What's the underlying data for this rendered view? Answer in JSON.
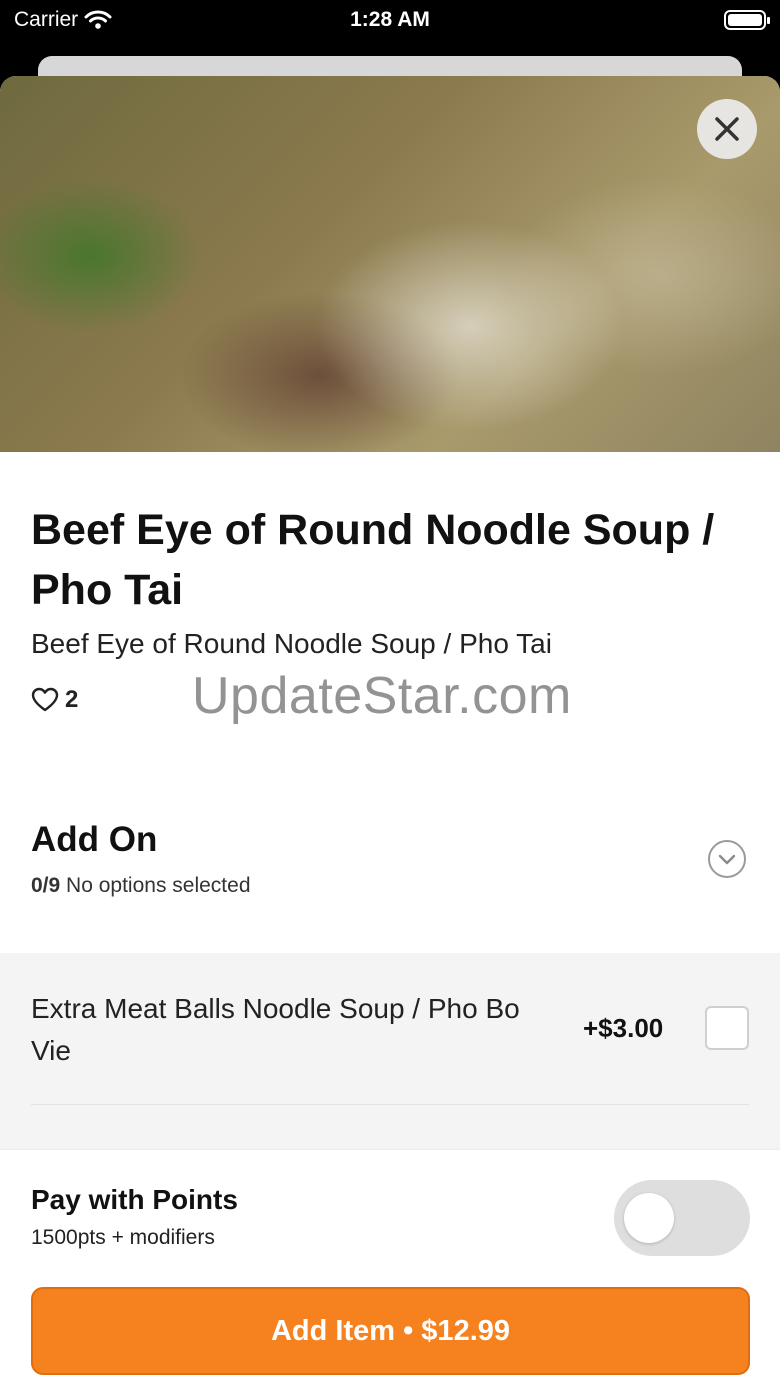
{
  "status_bar": {
    "carrier": "Carrier",
    "time": "1:28 AM"
  },
  "item": {
    "title": "Beef Eye of Round Noodle Soup / Pho Tai",
    "description": "Beef Eye of Round Noodle Soup / Pho Tai",
    "like_count": "2"
  },
  "watermark": "UpdateStar.com",
  "addon": {
    "title": "Add On",
    "selected_count": "0/9",
    "selected_text": "No options selected",
    "options": [
      {
        "label": "Extra Meat Balls Noodle Soup / Pho Bo Vie",
        "price": "+$3.00",
        "checked": false
      }
    ]
  },
  "points": {
    "title": "Pay with Points",
    "subtitle": "1500pts + modifiers",
    "enabled": false
  },
  "cta": {
    "label": "Add Item • $12.99"
  },
  "colors": {
    "accent": "#f6811f"
  }
}
